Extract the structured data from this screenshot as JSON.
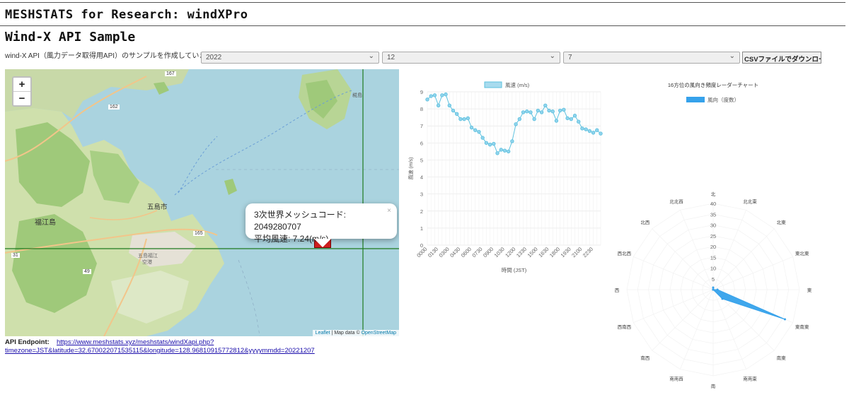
{
  "header": {
    "site_title": "MESHSTATS for Research: windXPro",
    "page_title": "Wind-X API Sample",
    "description": "wind-X API（風力データ取得用API）のサンプルを作成しています。"
  },
  "controls": {
    "year": "2022",
    "month": "12",
    "day": "7",
    "csv_button": "CSVファイルでダウンロード"
  },
  "map": {
    "zoom_in": "+",
    "zoom_out": "−",
    "labels": {
      "fukue": "福江島",
      "goto": "五島市",
      "airport1": "五島福江",
      "airport2": "空港",
      "road162": "162",
      "road167": "167",
      "road165": "165",
      "road31": "31",
      "road49": "49",
      "kuba": "椛島"
    },
    "popup_line1": "3次世界メッシュコード: 2049280707",
    "popup_line2": "平均風速: 7.24(m/s)",
    "popup_close": "×",
    "attribution_leaflet": "Leaflet",
    "attribution_mid": "| Map data ©",
    "attribution_osm": "OpenStreetMap"
  },
  "api": {
    "label": "API Endpoint:",
    "url_part1": "https://www.meshstats.xyz/meshstats/windXapi.php?",
    "url_part2": "timezone=JST&latitude=32.670022071535115&longitude=128.96810915772812&yyyymmdd=20221207"
  },
  "chart_data": [
    {
      "type": "line",
      "legend": "風速 (m/s)",
      "xlabel": "時間 (JST)",
      "ylabel": "風速 (m/s)",
      "ylim": [
        0,
        9
      ],
      "yticks": [
        0,
        1,
        2,
        3,
        4,
        5,
        6,
        7,
        8,
        9
      ],
      "xtick_labels": [
        "0000",
        "0130",
        "0300",
        "0430",
        "0600",
        "0730",
        "0900",
        "1030",
        "1200",
        "1330",
        "1500",
        "1630",
        "1800",
        "1930",
        "2100",
        "2230"
      ],
      "x": [
        "0000",
        "0030",
        "0100",
        "0130",
        "0200",
        "0230",
        "0300",
        "0330",
        "0400",
        "0430",
        "0500",
        "0530",
        "0600",
        "0630",
        "0700",
        "0730",
        "0800",
        "0830",
        "0900",
        "0930",
        "1000",
        "1030",
        "1100",
        "1130",
        "1200",
        "1230",
        "1300",
        "1330",
        "1400",
        "1430",
        "1500",
        "1530",
        "1600",
        "1630",
        "1700",
        "1730",
        "1800",
        "1830",
        "1900",
        "1930",
        "2000",
        "2030",
        "2100",
        "2130",
        "2200",
        "2230",
        "2300",
        "2330"
      ],
      "values": [
        8.55,
        8.75,
        8.8,
        8.2,
        8.8,
        8.85,
        8.2,
        7.9,
        7.7,
        7.4,
        7.4,
        7.45,
        6.9,
        6.75,
        6.65,
        6.3,
        6.0,
        5.9,
        5.95,
        5.4,
        5.6,
        5.55,
        5.5,
        6.1,
        7.1,
        7.4,
        7.8,
        7.85,
        7.8,
        7.4,
        7.9,
        7.8,
        8.2,
        7.9,
        7.85,
        7.3,
        7.9,
        7.95,
        7.45,
        7.4,
        7.6,
        7.25,
        6.85,
        6.8,
        6.7,
        6.6,
        6.75,
        6.55
      ],
      "series_color": "#5bc0de",
      "grid": true,
      "legend_position": "top"
    },
    {
      "type": "radar",
      "title": "16方位の風向き頻度レーダーチャート",
      "legend": "風向（度数）",
      "directions": [
        "北",
        "北北東",
        "北東",
        "東北東",
        "東",
        "東南東",
        "南東",
        "南南東",
        "南",
        "南南西",
        "南西",
        "西南西",
        "西",
        "西北西",
        "北西",
        "北北西"
      ],
      "rlim": [
        0,
        40
      ],
      "rticks": [
        5,
        10,
        15,
        20,
        25,
        30,
        35,
        40
      ],
      "values": [
        1,
        0,
        0,
        0,
        2,
        36,
        6,
        0,
        0,
        0,
        0,
        0,
        0,
        0,
        0,
        0
      ],
      "series_color": "#36a2eb",
      "legend_position": "top"
    }
  ]
}
